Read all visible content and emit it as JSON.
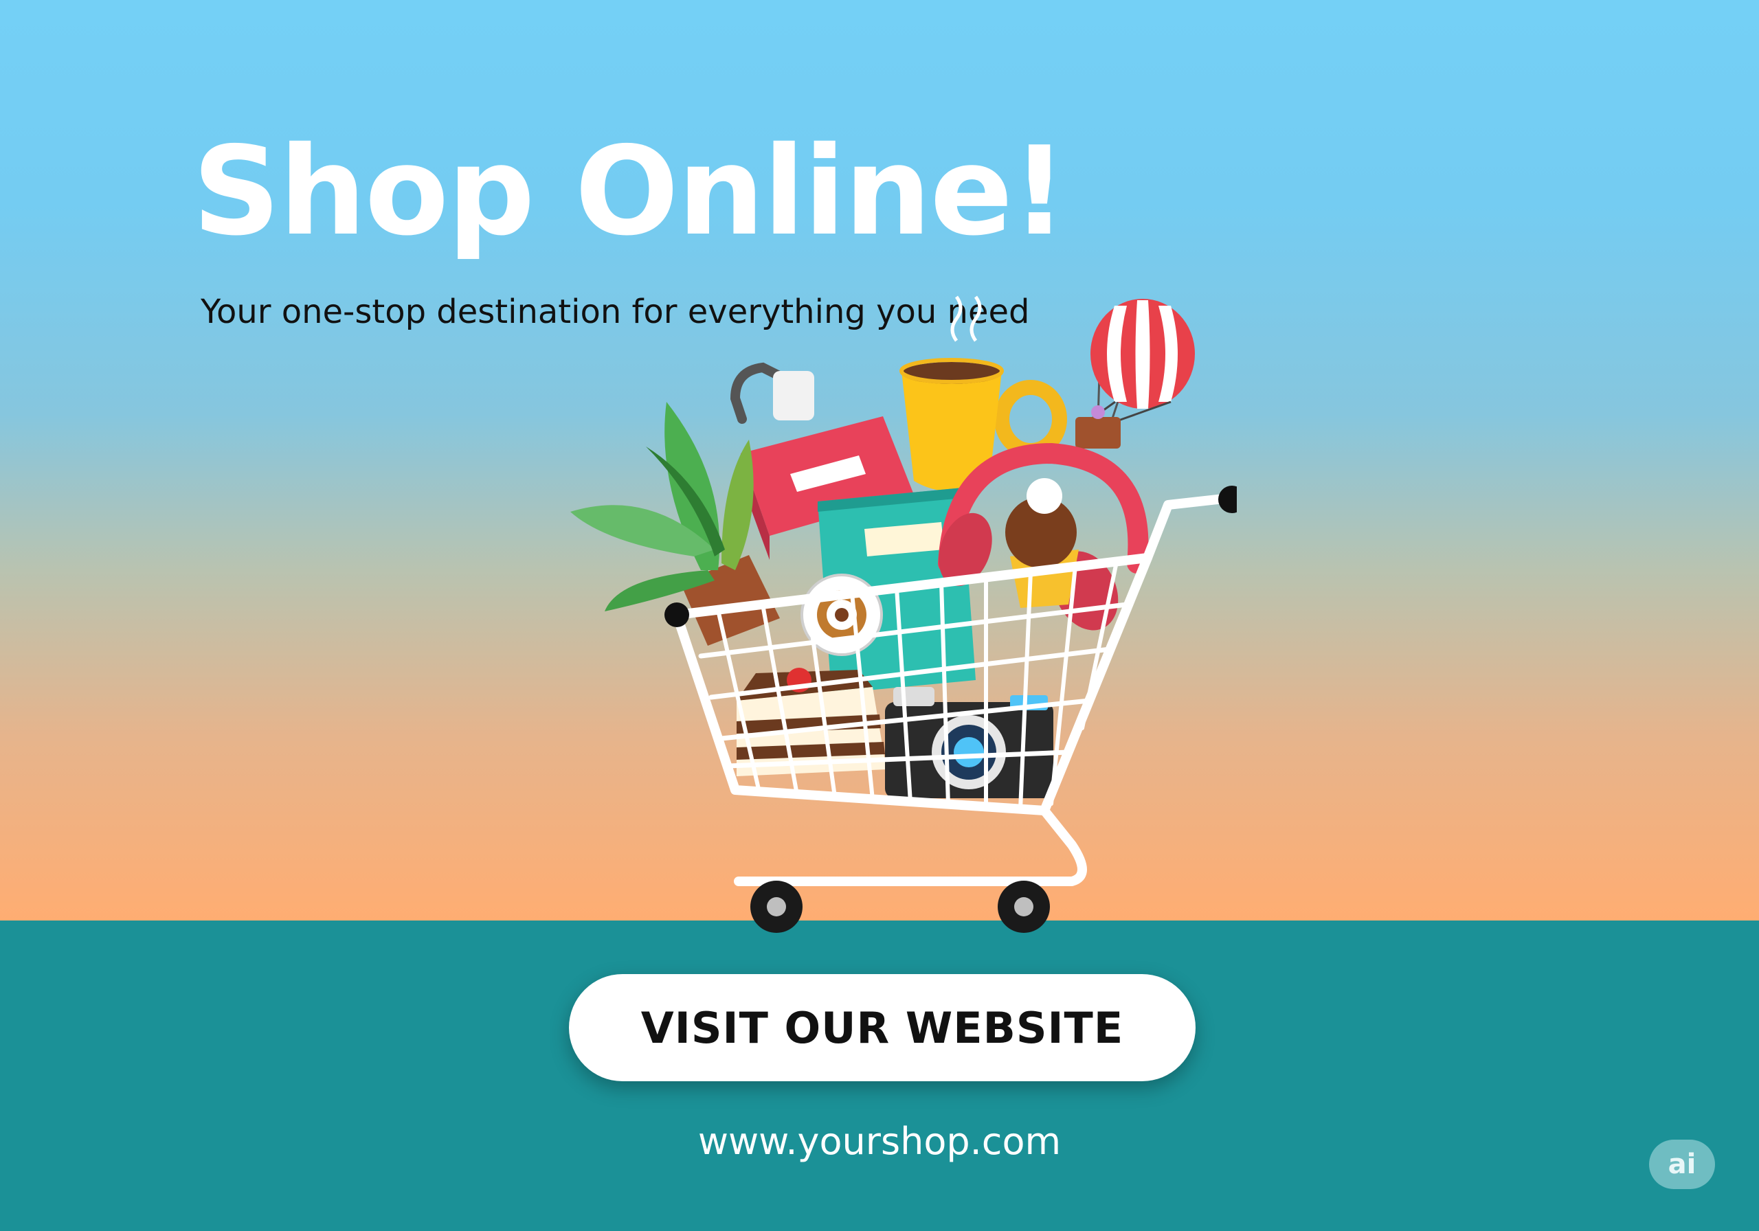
{
  "banner": {
    "headline": "Shop Online!",
    "tagline": "Your one-stop destination for everything you need",
    "cta_label": "VISIT OUR WEBSITE",
    "url": "www.yourshop.com",
    "badge": "ai"
  },
  "colors": {
    "sky_top": "#74d0f6",
    "sky_bottom": "#ffad72",
    "floor": "#1b9197",
    "headline": "#ffffff",
    "button": "#ffffff",
    "button_text": "#111111"
  },
  "illustration": {
    "cart_items": [
      "plant-pot",
      "handbag",
      "books",
      "coffee-mug",
      "hot-air-balloon",
      "headphones",
      "cupcake",
      "cake-slice",
      "camera",
      "tape-measure"
    ]
  }
}
